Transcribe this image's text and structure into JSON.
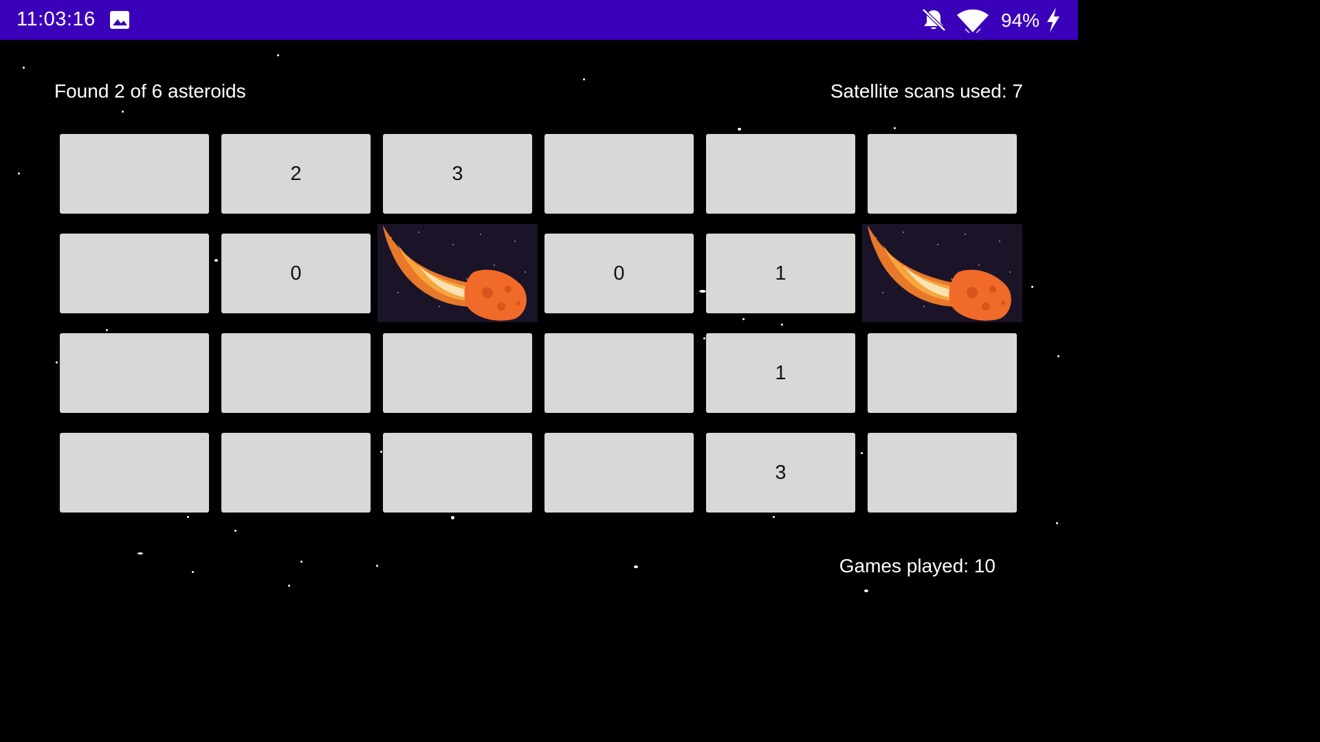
{
  "status_bar": {
    "time": "11:03:16",
    "battery": "94%",
    "icons": [
      "gallery-icon",
      "bell-off-icon",
      "wifi-icon",
      "charging-bolt-icon"
    ],
    "color": "#3b00b9"
  },
  "game": {
    "found_text": "Found 2 of 6 asteroids",
    "scans_text": "Satellite scans used: 7",
    "games_played_text": "Games played: 10",
    "grid": {
      "columns": 6,
      "rows": [
        [
          "",
          "2",
          "3",
          "",
          "",
          ""
        ],
        [
          "",
          "0",
          "asteroid",
          "0",
          "1",
          "asteroid"
        ],
        [
          "",
          "",
          "",
          "",
          "1",
          ""
        ],
        [
          "",
          "",
          "",
          "",
          "3",
          ""
        ]
      ]
    }
  },
  "colors": {
    "background": "#000000",
    "cell": "#d8d8d8",
    "asteroid_body": "#f06a2a",
    "flame": "#f59a2e"
  }
}
